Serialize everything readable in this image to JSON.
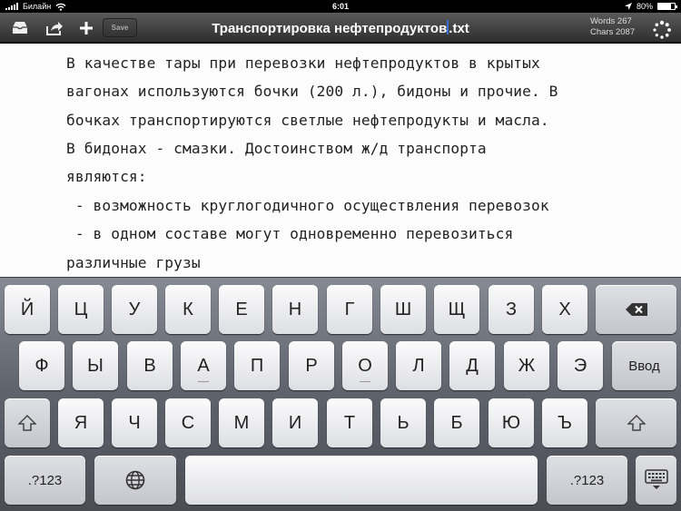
{
  "status": {
    "carrier": "Билайн",
    "time": "6:01",
    "battery": "80%",
    "battery_level": 0.8
  },
  "toolbar": {
    "save_label": "Save",
    "title_main": "Транспортировка нефтепродуктов",
    "title_ext": ".txt",
    "words_label": "Words 267",
    "chars_label": "Chars 2087"
  },
  "document": {
    "lines": [
      "В качестве тары при перевозки нефтепродуктов в крытых",
      "вагонах используются бочки (200 л.), бидоны и прочие. В",
      "бочках транспортируются светлые нефтепродукты и масла.",
      "В бидонах - смазки. Достоинством ж/д транспорта",
      "являются:",
      " - возможность круглогодичного осуществления перевозок",
      " - в одном составе могут одновременно перевозиться",
      "различные грузы"
    ]
  },
  "keyboard": {
    "row1": [
      "Й",
      "Ц",
      "У",
      "К",
      "Е",
      "Н",
      "Г",
      "Ш",
      "Щ",
      "З",
      "Х"
    ],
    "row2": [
      "Ф",
      "Ы",
      "В",
      "А",
      "П",
      "Р",
      "О",
      "Л",
      "Д",
      "Ж",
      "Э"
    ],
    "row3": [
      "Я",
      "Ч",
      "С",
      "М",
      "И",
      "Т",
      "Ь",
      "Б",
      "Ю",
      "Ъ"
    ],
    "return_label": "Ввод",
    "numbers_label": ".?123"
  },
  "colors": {
    "toolbar": "#3a3a3a",
    "cursor": "#3b6fd6",
    "paper": "#fcfcfc"
  },
  "icons": {
    "inbox": "inbox-icon",
    "share": "share-icon",
    "add": "plus-icon",
    "sync": "sync-icon",
    "backspace": "backspace-icon",
    "shift": "shift-icon",
    "globe": "globe-icon",
    "hide_keyboard": "keyboard-hide-icon"
  }
}
